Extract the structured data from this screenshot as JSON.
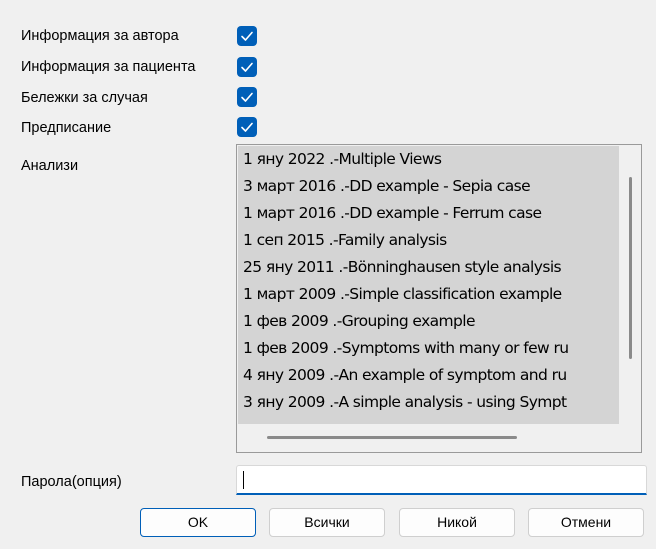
{
  "options": [
    {
      "label": "Информация за автора",
      "checked": true
    },
    {
      "label": "Информация за пациента",
      "checked": true
    },
    {
      "label": "Бележки за случая",
      "checked": true
    },
    {
      "label": "Предписание",
      "checked": true
    }
  ],
  "analyses": {
    "label": "Анализи",
    "items": [
      "1 яну 2022 .-Multiple Views",
      "3 март 2016 .-DD example - Sepia case",
      "1 март 2016 .-DD example - Ferrum case",
      "1 сеп 2015 .-Family analysis",
      "25 яну 2011 .-Bönninghausen style analysis",
      "1 март 2009 .-Simple classification example",
      "1 фев 2009 .-Grouping example",
      "1 фев 2009 .-Symptoms with many or few ru",
      "4 яну 2009 .-An example of symptom and ru",
      "3 яну 2009 .-A simple analysis - using Sympt"
    ]
  },
  "password": {
    "label": "Парола(опция)",
    "value": ""
  },
  "buttons": {
    "ok": "OK",
    "all": "Всички",
    "none": "Никой",
    "cancel": "Отмени"
  },
  "colors": {
    "accent": "#005fb8",
    "list_bg": "#d4d4d4",
    "window_bg": "#f0f0f0"
  }
}
